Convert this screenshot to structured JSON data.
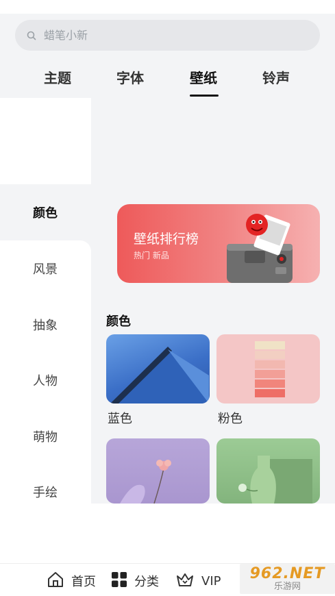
{
  "search": {
    "placeholder": "蜡笔小新"
  },
  "tabs": [
    {
      "label": "主题"
    },
    {
      "label": "字体"
    },
    {
      "label": "壁纸"
    },
    {
      "label": "铃声"
    }
  ],
  "active_tab": "壁纸",
  "sidebar": {
    "items": [
      {
        "label": "颜色"
      },
      {
        "label": "风景"
      },
      {
        "label": "抽象"
      },
      {
        "label": "人物"
      },
      {
        "label": "萌物"
      },
      {
        "label": "手绘"
      }
    ]
  },
  "banner": {
    "title": "壁纸排行榜",
    "subtitle": "热门 新品"
  },
  "section": {
    "title": "颜色",
    "cards": [
      {
        "label": "蓝色"
      },
      {
        "label": "粉色"
      },
      {
        "label": ""
      },
      {
        "label": ""
      }
    ]
  },
  "bottom_nav": {
    "items": [
      {
        "label": "首页",
        "icon": "home-icon"
      },
      {
        "label": "分类",
        "icon": "grid-icon"
      },
      {
        "label": "VIP",
        "icon": "crown-icon"
      }
    ]
  },
  "watermark": {
    "main": "962.NET",
    "sub": "乐游网"
  },
  "colors": {
    "accent_red": "#ee5a5a",
    "background": "#f3f4f6",
    "card_blue": "#3b6fc7",
    "card_pink": "#f4c6c6",
    "card_lavender": "#b8a6d8",
    "card_green": "#8fbf8a"
  }
}
